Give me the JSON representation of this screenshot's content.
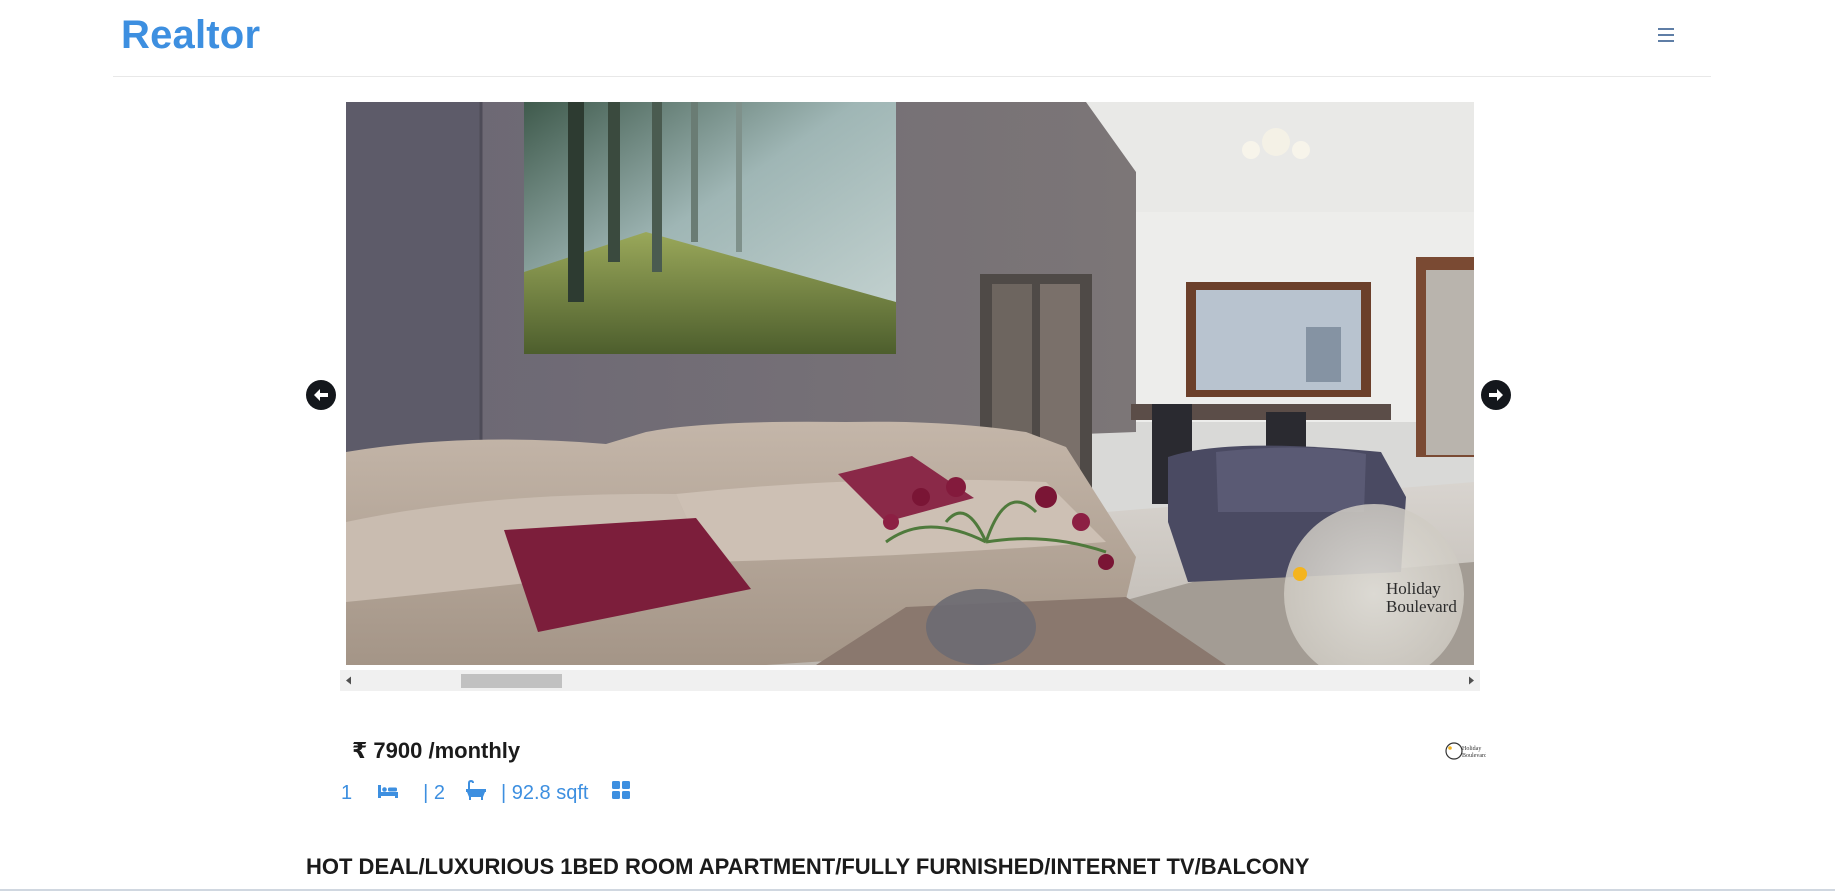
{
  "brand": {
    "name": "Realtor",
    "color": "#3d8fe0"
  },
  "navbar": {
    "menu_icon": "hamburger-menu-icon"
  },
  "carousel": {
    "prev_icon": "arrow-left-circle-icon",
    "next_icon": "arrow-right-circle-icon",
    "watermark": "Holiday Boulevard",
    "scrollbar": {
      "left_icon": "scroll-left-arrow-icon",
      "right_icon": "scroll-right-arrow-icon"
    }
  },
  "listing": {
    "price": "₹ 7900 /monthly",
    "agency_logo_text": "Holiday Boulevard",
    "bedrooms": "1",
    "bathrooms": "| 2",
    "area": "| 92.8 sqft",
    "bed_icon": "bed-icon",
    "bath_icon": "bathtub-icon",
    "area_icon": "grid-icon",
    "title": "HOT DEAL/LUXURIOUS 1BED ROOM APARTMENT/FULLY FURNISHED/INTERNET TV/BALCONY"
  }
}
